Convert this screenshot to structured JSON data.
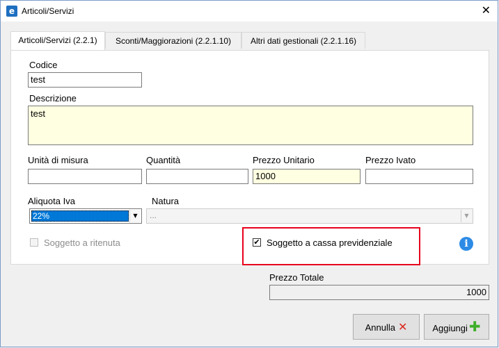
{
  "window": {
    "title": "Articoli/Servizi",
    "app_icon": "e",
    "close": "✕"
  },
  "tabs": [
    {
      "label": "Articoli/Servizi (2.2.1)",
      "active": true
    },
    {
      "label": "Sconti/Maggiorazioni (2.2.1.10)",
      "active": false
    },
    {
      "label": "Altri dati gestionali (2.2.1.16)",
      "active": false
    }
  ],
  "form": {
    "codice": {
      "label": "Codice",
      "value": "test"
    },
    "descrizione": {
      "label": "Descrizione",
      "value": "test"
    },
    "unita_misura": {
      "label": "Unità di misura",
      "value": ""
    },
    "quantita": {
      "label": "Quantità",
      "value": ""
    },
    "prezzo_unitario": {
      "label": "Prezzo Unitario",
      "value": "1000"
    },
    "prezzo_ivato": {
      "label": "Prezzo Ivato",
      "value": ""
    },
    "aliquota_iva": {
      "label": "Aliquota Iva",
      "value": "22%"
    },
    "natura": {
      "label": "Natura",
      "value": "..."
    },
    "soggetto_ritenuta": {
      "label": "Soggetto a ritenuta",
      "checked": false,
      "enabled": false
    },
    "soggetto_cassa": {
      "label": "Soggetto a cassa previdenziale",
      "checked": true,
      "check_glyph": "✔"
    }
  },
  "totale": {
    "label": "Prezzo Totale",
    "value": "1000"
  },
  "buttons": {
    "annulla": {
      "label": "Annulla",
      "icon": "✕"
    },
    "aggiungi": {
      "label": "Aggiungi",
      "icon": "✚"
    }
  },
  "info_icon": "i",
  "dropdown_arrow": "▼",
  "colors": {
    "highlight": "#e8001c",
    "selection": "#0078d7",
    "info": "#2d8be6",
    "cancel": "#d9281c",
    "add": "#3fae2a",
    "input_yellow": "#ffffe1"
  }
}
